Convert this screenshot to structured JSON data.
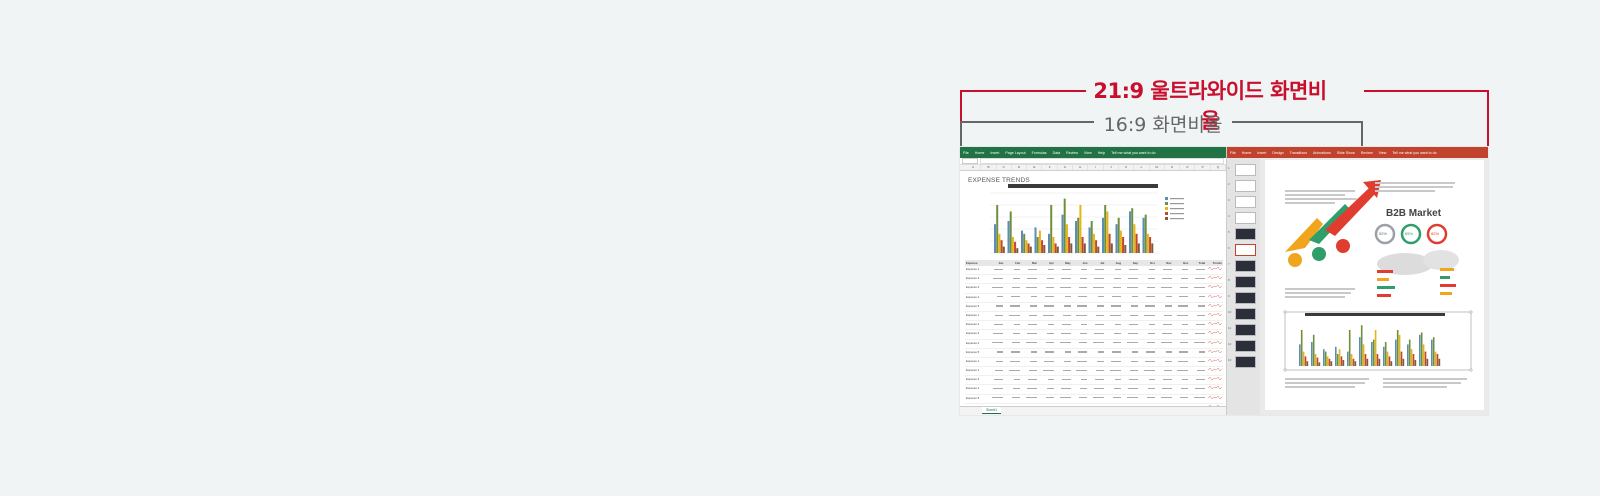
{
  "annotations": {
    "ultrawide_label": "21:9 울트라와이드 화면비율",
    "standard_label": "16:9 화면비율",
    "ultrawide_color": "#c8102e",
    "standard_color": "#666666"
  },
  "excel": {
    "ribbon_color": "#217346",
    "menu": [
      "File",
      "Home",
      "Insert",
      "Page Layout",
      "Formulas",
      "Data",
      "Review",
      "View",
      "Help",
      "Tell me what you want to do"
    ],
    "columns": [
      "A",
      "B",
      "C",
      "D",
      "E",
      "F",
      "G",
      "H",
      "I",
      "J",
      "K",
      "L",
      "M",
      "N",
      "O",
      "P",
      "Q"
    ],
    "sheet_title": "EXPENSE TRENDS",
    "sheet_tab": "Sheet1",
    "table_header": [
      "Expense",
      "Jan",
      "Feb",
      "Mar",
      "Apr",
      "May",
      "Jun",
      "Jul",
      "Aug",
      "Sep",
      "Oct",
      "Nov",
      "Dec",
      "Total",
      "Trends"
    ],
    "row_labels": [
      "Expense 1",
      "Expense 2",
      "Expense 3",
      "Expense 4",
      "Expense 5",
      "Expense 1",
      "Expense 2",
      "Expense 3",
      "Expense 4",
      "Expense 5",
      "Expense 1",
      "Expense 2",
      "Expense 3",
      "Expense 4",
      "Expense 5",
      "Total"
    ]
  },
  "powerpoint": {
    "ribbon_color": "#c1432e",
    "menu": [
      "File",
      "Home",
      "Insert",
      "Design",
      "Transitions",
      "Animations",
      "Slide Show",
      "Review",
      "View",
      "Tell me what you want to do"
    ],
    "slide_title": "B2B Market",
    "donut_values": [
      "52%",
      "65%",
      "82%"
    ],
    "thumb_numbers": [
      "1",
      "2",
      "3",
      "4",
      "5",
      "6",
      "7",
      "8",
      "9",
      "10",
      "11",
      "12",
      "13"
    ]
  }
}
